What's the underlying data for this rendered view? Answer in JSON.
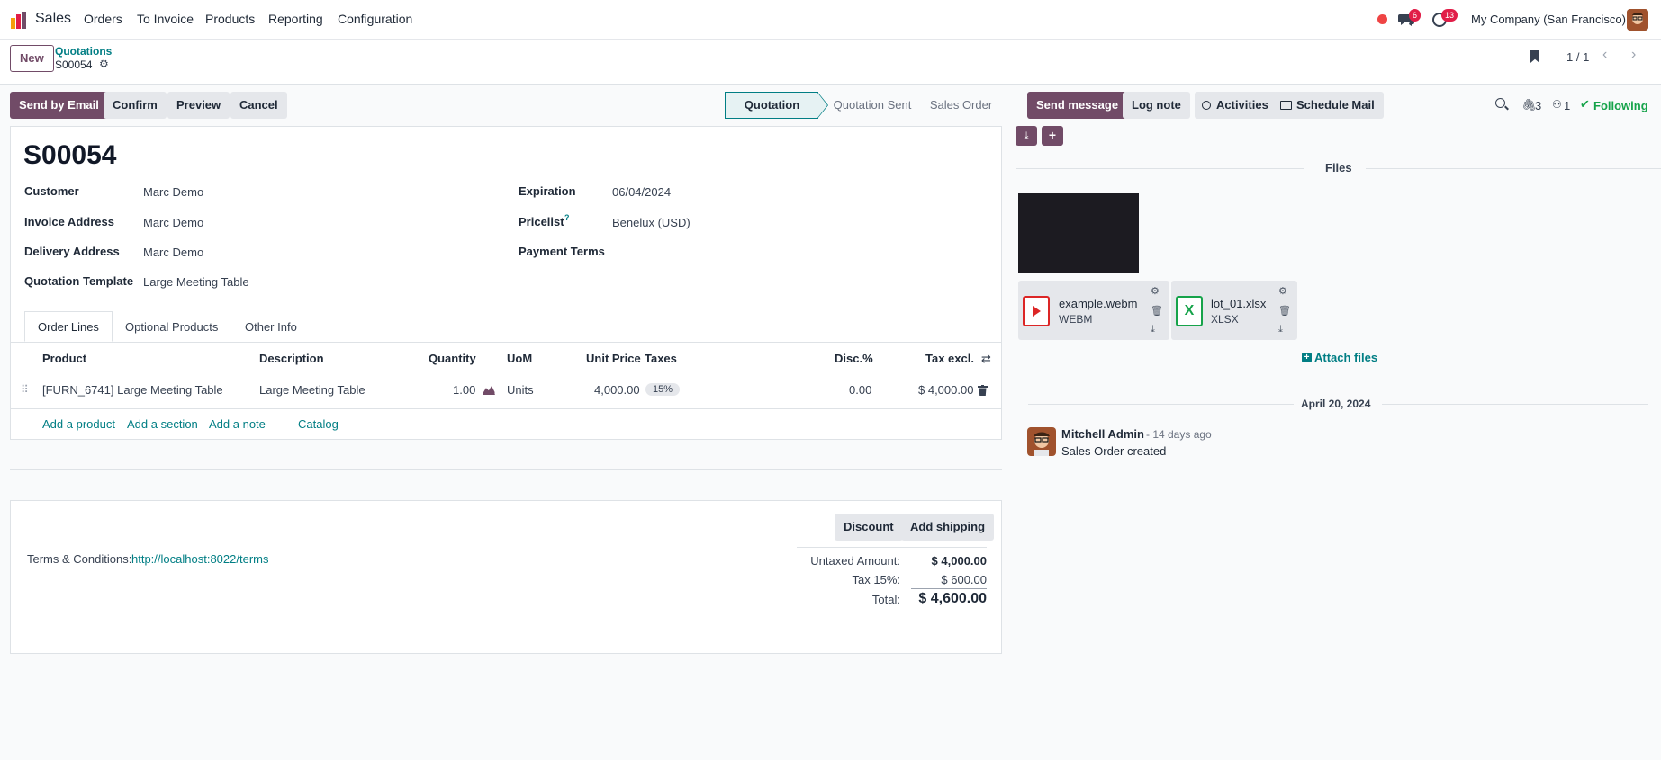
{
  "navbar": {
    "app_name": "Sales",
    "menu": [
      "Orders",
      "To Invoice",
      "Products",
      "Reporting",
      "Configuration"
    ],
    "messages_count": "6",
    "activities_count": "13",
    "company": "My Company (San Francisco)"
  },
  "control_panel": {
    "new_label": "New",
    "breadcrumb_parent": "Quotations",
    "breadcrumb_current": "S00054",
    "pager": "1 / 1"
  },
  "actions": {
    "send_by_email": "Send by Email",
    "confirm": "Confirm",
    "preview": "Preview",
    "cancel": "Cancel"
  },
  "statusbar": [
    "Quotation",
    "Quotation Sent",
    "Sales Order"
  ],
  "form": {
    "title": "S00054",
    "customer_label": "Customer",
    "customer": "Marc Demo",
    "invoice_address_label": "Invoice Address",
    "invoice_address": "Marc Demo",
    "delivery_address_label": "Delivery Address",
    "delivery_address": "Marc Demo",
    "quotation_template_label": "Quotation Template",
    "quotation_template": "Large Meeting Table",
    "expiration_label": "Expiration",
    "expiration": "06/04/2024",
    "pricelist_label": "Pricelist",
    "pricelist_help": "?",
    "pricelist": "Benelux (USD)",
    "payment_terms_label": "Payment Terms"
  },
  "tabs": [
    "Order Lines",
    "Optional Products",
    "Other Info"
  ],
  "order_lines": {
    "headers": [
      "Product",
      "Description",
      "Quantity",
      "UoM",
      "Unit Price",
      "Taxes",
      "Disc.%",
      "Tax excl."
    ],
    "rows": [
      {
        "product": "[FURN_6741] Large Meeting Table",
        "description": "Large Meeting Table",
        "quantity": "1.00",
        "uom": "Units",
        "unit_price": "4,000.00",
        "taxes": "15%",
        "discount": "0.00",
        "subtotal": "$ 4,000.00"
      }
    ],
    "add_product": "Add a product",
    "add_section": "Add a section",
    "add_note": "Add a note",
    "catalog": "Catalog"
  },
  "footer": {
    "discount_btn": "Discount",
    "shipping_btn": "Add shipping",
    "terms_label": "Terms & Conditions:",
    "terms_link": "http://localhost:8022/terms",
    "untaxed_label": "Untaxed Amount:",
    "untaxed_value": "$ 4,000.00",
    "tax_label": "Tax 15%:",
    "tax_value": "$ 600.00",
    "total_label": "Total:",
    "total_value": "$ 4,600.00"
  },
  "chatter": {
    "send_message": "Send message",
    "log_note": "Log note",
    "activities": "Activities",
    "schedule_mail": "Schedule Mail",
    "attachments_count": "3",
    "followers_count": "1",
    "following": "Following",
    "files_heading": "Files",
    "files": [
      {
        "name": "example.webm",
        "type": "WEBM"
      },
      {
        "name": "lot_01.xlsx",
        "type": "XLSX"
      }
    ],
    "attach_files": "Attach files",
    "date_separator": "April 20, 2024",
    "message": {
      "author": "Mitchell Admin",
      "time": "- 14 days ago",
      "body": "Sales Order created"
    }
  }
}
